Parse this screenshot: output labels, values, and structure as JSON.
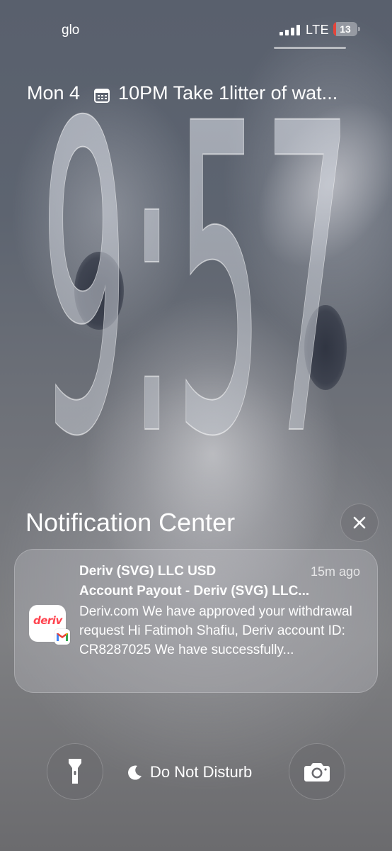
{
  "status_bar": {
    "carrier": "glo",
    "network": "LTE",
    "battery_level": "13",
    "battery_fraction": 0.13
  },
  "lock_screen": {
    "date": "Mon 4",
    "reminder": "10PM Take 1litter of wat...",
    "time": "9:57"
  },
  "notification_center": {
    "title": "Notification Center",
    "close_icon": "close-icon"
  },
  "notification": {
    "app_label": "deriv",
    "title_line1": "Deriv (SVG) LLC USD",
    "title_line2": "Account Payout - Deriv (SVG) LLC...",
    "time": "15m ago",
    "body": "Deriv.com We have approved your withdrawal request Hi Fatimoh Shafiu, Deriv account ID: CR8287025 We have successfully..."
  },
  "controls": {
    "flashlight_icon": "flashlight-icon",
    "focus_label": "Do Not Disturb",
    "camera_icon": "camera-icon"
  },
  "colors": {
    "battery_low": "#e5443a",
    "deriv_brand": "#ff444f"
  }
}
